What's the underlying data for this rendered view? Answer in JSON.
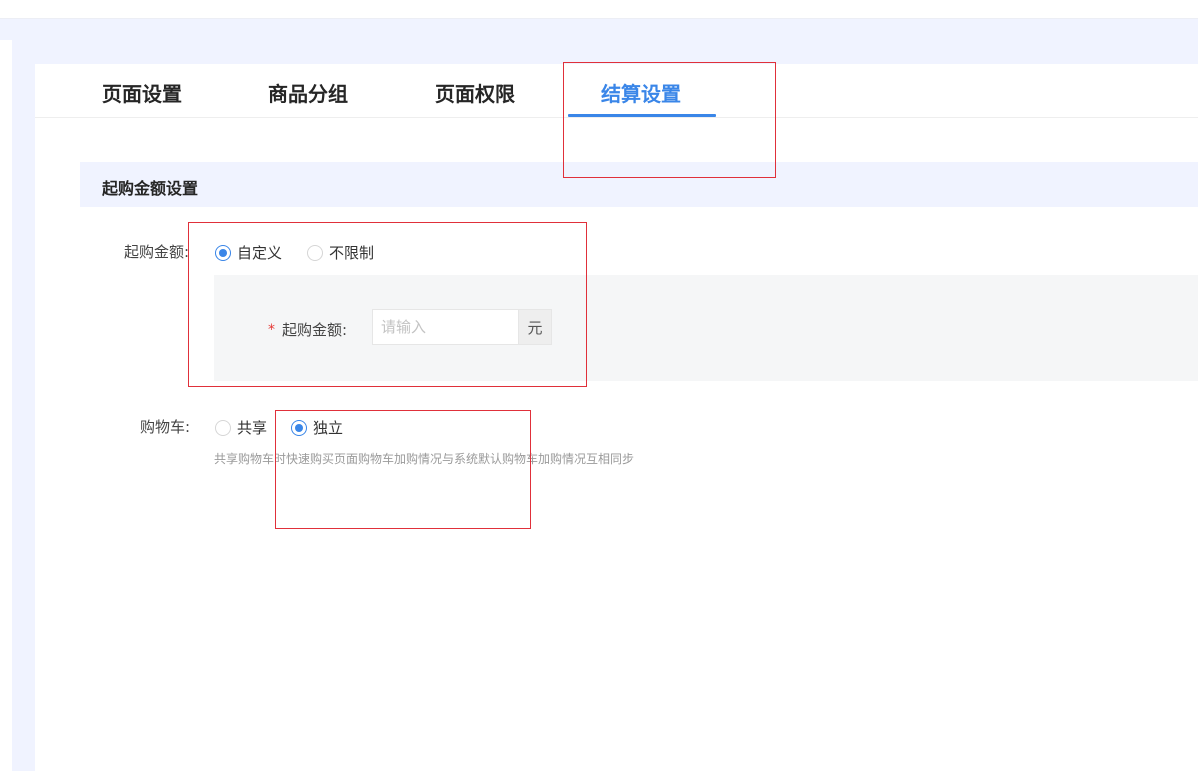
{
  "tabs": [
    {
      "label": "页面设置",
      "active": false
    },
    {
      "label": "商品分组",
      "active": false
    },
    {
      "label": "页面权限",
      "active": false
    },
    {
      "label": "结算设置",
      "active": true
    }
  ],
  "section": {
    "title": "起购金额设置"
  },
  "min_amount": {
    "label": "起购金额:",
    "options": [
      {
        "label": "自定义",
        "checked": true
      },
      {
        "label": "不限制",
        "checked": false
      }
    ],
    "field_label": "起购金额:",
    "required_mark": "*",
    "input_value": "",
    "input_placeholder": "请输入",
    "unit": "元"
  },
  "cart": {
    "label": "购物车:",
    "options": [
      {
        "label": "共享",
        "checked": false
      },
      {
        "label": "独立",
        "checked": true
      }
    ],
    "help": "共享购物车时快速购买页面购物车加购情况与系统默认购物车加购情况互相同步"
  },
  "colors": {
    "accent": "#3a86e8",
    "highlight_box": "#e0303a",
    "required": "#e53935"
  }
}
